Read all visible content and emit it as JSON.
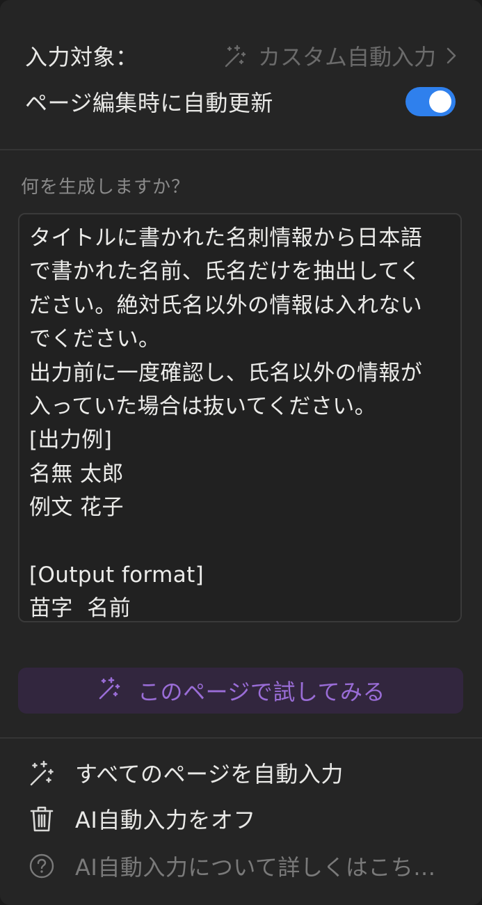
{
  "header": {
    "target_label": "入力対象：",
    "target_value": "カスタム自動入力",
    "auto_update_label": "ページ編集時に自動更新",
    "auto_update_on": true
  },
  "prompt": {
    "label": "何を生成しますか？",
    "text": "タイトルに書かれた名刺情報から日本語\nで書かれた名前、氏名だけを抽出してく\nださい。絶対氏名以外の情報は入れない\nでください。\n出力前に一度確認し、氏名以外の情報が\n入っていた場合は抜いてください。\n[出力例]\n名無 太郎\n例文 花子\n\n[Output format]\n苗字  名前"
  },
  "try_button": {
    "label": "このページで試してみる"
  },
  "menu": {
    "items": [
      {
        "label": "すべてのページを自動入力",
        "icon": "magic-wand-icon"
      },
      {
        "label": "AI自動入力をオフ",
        "icon": "trash-icon"
      },
      {
        "label": "AI自動入力について詳しくはこち...",
        "icon": "help-circle-icon"
      }
    ]
  },
  "colors": {
    "accent_blue": "#2f80ed",
    "accent_purple": "#9a6dd7",
    "background": "#252525"
  }
}
